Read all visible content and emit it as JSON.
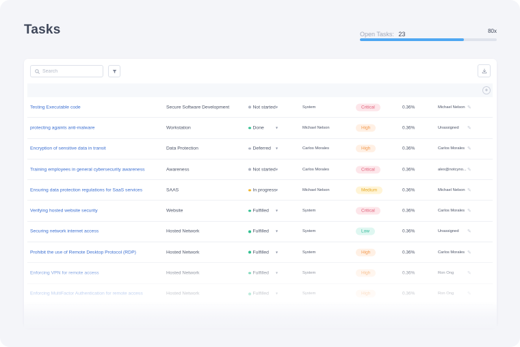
{
  "page": {
    "title": "Tasks"
  },
  "open_tasks": {
    "label": "Open Tasks:",
    "count": "23",
    "percent_label": "80x",
    "progress": 0.76
  },
  "toolbar": {
    "search_placeholder": "Search",
    "search_value": ""
  },
  "colors": {
    "accent": "#4fa7f2",
    "link": "#3b6fd1",
    "status_done": "#2fbf8f",
    "status_in_progress": "#f0b429",
    "status_neutral": "#b0b6c3"
  },
  "priority_styles": {
    "Critical": {
      "bg": "#fde6ea",
      "fg": "#e0607a"
    },
    "High": {
      "bg": "#fff0e4",
      "fg": "#f29a4f"
    },
    "Medium": {
      "bg": "#fff4d6",
      "fg": "#e6a821"
    },
    "Low": {
      "bg": "#dff7f1",
      "fg": "#2fb897"
    }
  },
  "rows": [
    {
      "task": "Testing Executable code",
      "category": "Secure Software Development",
      "status": "Not started",
      "status_color": "#b0b6c3",
      "assignee": "System",
      "priority": "Critical",
      "progress": "0.36%",
      "owner": "Michael Nelson"
    },
    {
      "task": "protecting againts anti-malware",
      "category": "Workstation",
      "status": "Done",
      "status_color": "#2fbf8f",
      "assignee": "Michael Nelson",
      "priority": "High",
      "progress": "0.36%",
      "owner": "Unassigned"
    },
    {
      "task": "Encryption of sensitive data in transit",
      "category": "Data Protection",
      "status": "Deferred",
      "status_color": "#b0b6c3",
      "assignee": "Carlos Morales",
      "priority": "High",
      "progress": "0.36%",
      "owner": "Carlos Morales"
    },
    {
      "task": "Training employees in general cybersecurity awareness",
      "category": "Awareness",
      "status": "Not started",
      "status_color": "#b0b6c3",
      "assignee": "Carlos Morales",
      "priority": "Critical",
      "progress": "0.36%",
      "owner": "alex@notcyno..."
    },
    {
      "task": "Ensuring data protection regulations for SaaS services",
      "category": "SAAS",
      "status": "In progress",
      "status_color": "#f0b429",
      "assignee": "Michael Nelson",
      "priority": "Medium",
      "progress": "0.36%",
      "owner": "Michael Nelson"
    },
    {
      "task": "Verifying hosted website security",
      "category": "Website",
      "status": "Fulfilled",
      "status_color": "#2fbf8f",
      "assignee": "System",
      "priority": "Critical",
      "progress": "0.36%",
      "owner": "Carlos Morales"
    },
    {
      "task": "Securing network internet access",
      "category": "Hosted Network",
      "status": "Fulfilled",
      "status_color": "#2fbf8f",
      "assignee": "System",
      "priority": "Low",
      "progress": "0.36%",
      "owner": "Unassigned"
    },
    {
      "task": "Prohibit the use of Remote Desktop Protocol (RDP)",
      "category": "Hosted Network",
      "status": "Fulfilled",
      "status_color": "#2fbf8f",
      "assignee": "System",
      "priority": "High",
      "progress": "0.36%",
      "owner": "Carlos Morales"
    },
    {
      "task": "Enforcing VPN for remote access",
      "category": "Hosted Network",
      "status": "Fulfilled",
      "status_color": "#2fbf8f",
      "assignee": "System",
      "priority": "High",
      "progress": "0.36%",
      "owner": "Ron Ong"
    },
    {
      "task": "Enforcing MultiFactor Authentication for remote access",
      "category": "Hosted Network",
      "status": "Fulfilled",
      "status_color": "#2fbf8f",
      "assignee": "System",
      "priority": "High",
      "progress": "0.36%",
      "owner": "Ron Ong"
    }
  ]
}
